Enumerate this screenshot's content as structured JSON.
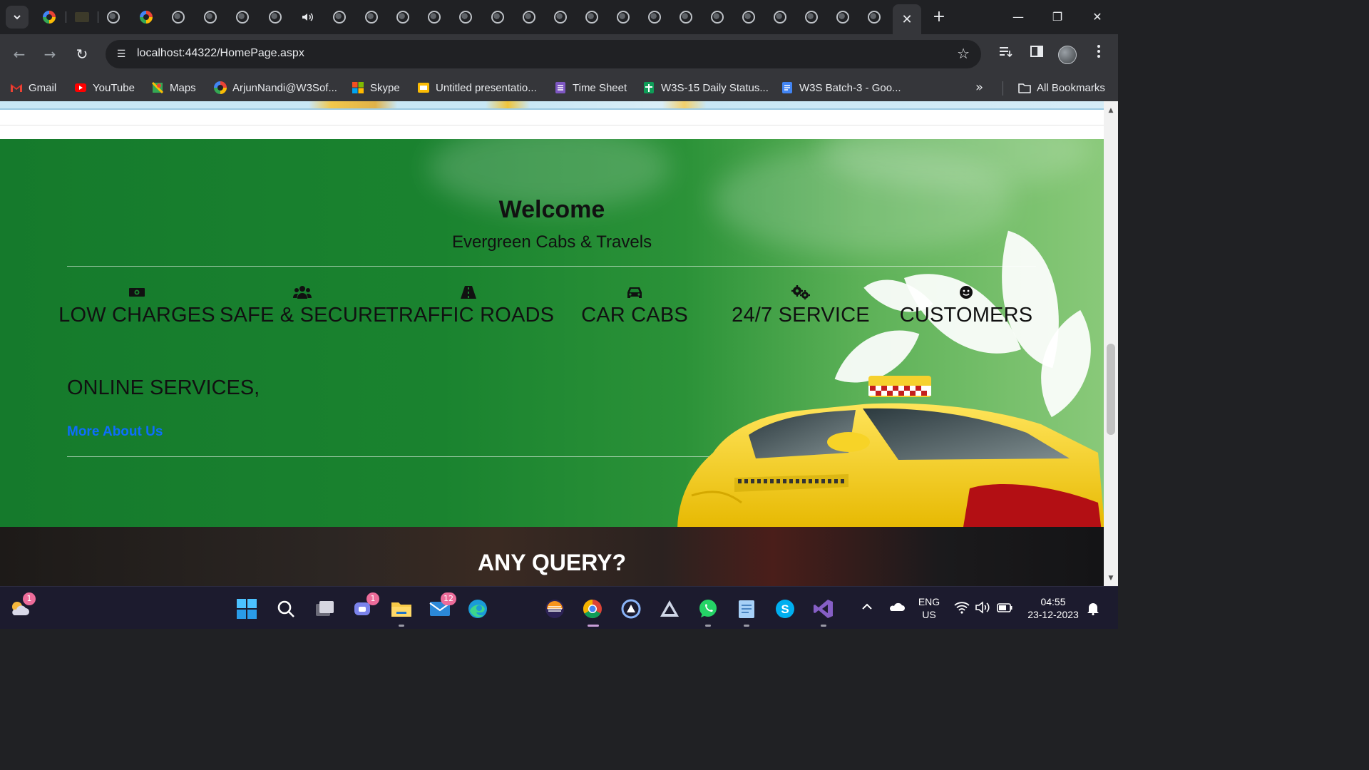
{
  "browser": {
    "address_url": "localhost:44322/HomePage.aspx",
    "tabs_close_glyph": "✕",
    "new_tab_glyph": "+",
    "window_controls": {
      "minimize": "—",
      "restore": "❐",
      "close": "✕"
    },
    "nav": {
      "back": "←",
      "forward": "→",
      "reload": "↻"
    },
    "site_info_glyph": "☰",
    "star_glyph": "☆",
    "toolbar_icons": [
      "reading-list-icon",
      "side-panel-icon",
      "profile-avatar",
      "kebab-menu-icon"
    ],
    "bookmarks": [
      {
        "label": "Gmail",
        "icon": "gmail-icon",
        "color": "#ea4335"
      },
      {
        "label": "YouTube",
        "icon": "youtube-icon",
        "color": "#ff0000"
      },
      {
        "label": "Maps",
        "icon": "maps-icon",
        "color": "#34a853"
      },
      {
        "label": "ArjunNandi@W3Sof...",
        "icon": "google-icon",
        "color": "#4285f4"
      },
      {
        "label": "Skype",
        "icon": "skype-windows-icon",
        "color": "#f25022"
      },
      {
        "label": "Untitled presentatio...",
        "icon": "slides-icon",
        "color": "#fbbc04"
      },
      {
        "label": "Time Sheet",
        "icon": "forms-icon",
        "color": "#7e57c2"
      },
      {
        "label": "W3S-15 Daily Status...",
        "icon": "sheets-icon",
        "color": "#0f9d58"
      },
      {
        "label": "W3S Batch-3 - Goo...",
        "icon": "docs-icon",
        "color": "#4285f4"
      }
    ],
    "bookmarks_overflow": "»",
    "all_bookmarks_label": "All Bookmarks"
  },
  "page": {
    "welcome_title": "Welcome",
    "welcome_subtitle": "Evergreen Cabs & Travels",
    "features": [
      {
        "label": "LOW CHARGES",
        "icon": "money-icon"
      },
      {
        "label": "SAFE & SECURE",
        "icon": "users-icon"
      },
      {
        "label": "TRAFFIC ROADS",
        "icon": "road-icon"
      },
      {
        "label": "CAR CABS",
        "icon": "car-icon"
      },
      {
        "label": "24/7 SERVICE",
        "icon": "gears-icon"
      },
      {
        "label": "CUSTOMERS",
        "icon": "smile-icon"
      }
    ],
    "online_services": "ONLINE SERVICES,",
    "more_about_link": "More About Us",
    "query_heading": "ANY QUERY?",
    "colors": {
      "green_bg": "#157a2c",
      "link_blue": "#0d6efd",
      "taxi_yellow": "#f4cf2a"
    }
  },
  "taskbar": {
    "weather_badge": "1",
    "teams_badge": "1",
    "mail_badge": "12",
    "apps": [
      "start-icon",
      "search-icon",
      "task-view-icon",
      "teams-chat-icon",
      "file-explorer-icon",
      "mail-icon",
      "edge-icon",
      "eclipse-icon",
      "chrome-icon",
      "azure-data-studio-icon",
      "app-triangle-icon",
      "whatsapp-icon",
      "notepad-icon",
      "skype-icon",
      "visual-studio-icon"
    ],
    "language": {
      "line1": "ENG",
      "line2": "US"
    },
    "clock": {
      "time": "04:55",
      "date": "23-12-2023"
    }
  }
}
